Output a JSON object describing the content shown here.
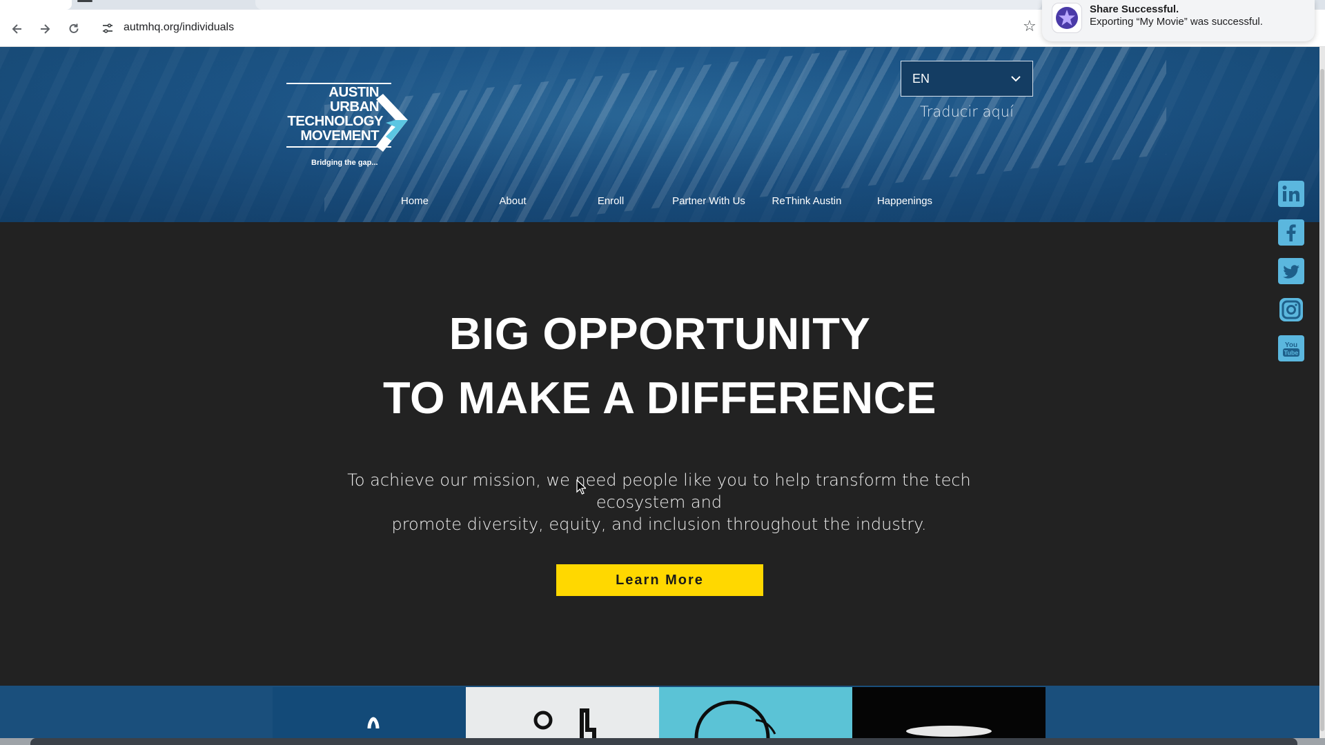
{
  "browser": {
    "url": "autmhq.org/individuals",
    "back_icon": "arrow-left-icon",
    "forward_icon": "arrow-right-icon",
    "reload_icon": "reload-icon",
    "bookmark_icon": "star-icon"
  },
  "notification": {
    "title": "Share Successful.",
    "body": "Exporting “My Movie” was successful.",
    "icon": "imovie-star-icon"
  },
  "logo": {
    "lines": [
      "AUSTIN",
      "URBAN",
      "TECHNOLOGY",
      "MOVEMENT"
    ],
    "tagline": "Bridging the gap..."
  },
  "language": {
    "selected": "EN",
    "translate_link": "Traducir aquí"
  },
  "nav": {
    "items": [
      "Home",
      "About",
      "Enroll",
      "Partner With Us",
      "ReThink Austin",
      "Happenings"
    ]
  },
  "hero": {
    "title_line1": "BIG OPPORTUNITY",
    "title_line2": "TO MAKE A DIFFERENCE",
    "subtitle_line1": "To achieve our mission, we need people like you to help transform the tech ecosystem and",
    "subtitle_line2": "promote diversity, equity, and inclusion throughout the industry.",
    "cta_label": "Learn More"
  },
  "social": [
    "linkedin-icon",
    "facebook-icon",
    "twitter-icon",
    "instagram-icon",
    "youtube-icon"
  ],
  "colors": {
    "header_blue": "#1d5688",
    "hero_bg": "#222222",
    "cta_yellow": "#ffd800",
    "social_blue": "#5bb7de",
    "logo_accent": "#5bc6e2"
  }
}
